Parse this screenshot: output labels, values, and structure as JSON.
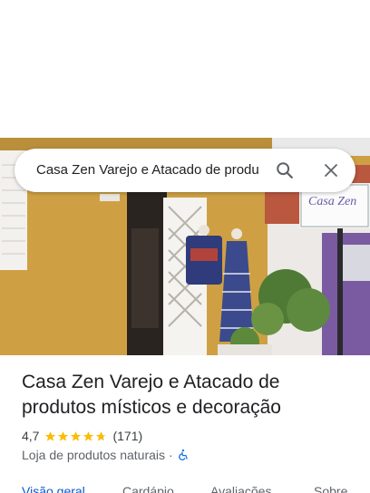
{
  "search": {
    "query": "Casa Zen Varejo e Atacado de produ"
  },
  "icons": {
    "search": "search-icon",
    "close": "close-icon",
    "wheelchair": "wheelchair-accessible-icon",
    "star": "star-icon"
  },
  "photo": {
    "sign_text": "Casa Zen"
  },
  "place": {
    "name": "Casa Zen Varejo e Atacado de produtos místicos e decoração",
    "rating": "4,7",
    "rating_value": 4.7,
    "review_count": "(171)",
    "category": "Loja de produtos naturais",
    "separator": "·"
  },
  "tabs": [
    {
      "label": "Visão geral",
      "active": true
    },
    {
      "label": "Cardápio",
      "active": false
    },
    {
      "label": "Avaliações",
      "active": false
    },
    {
      "label": "Sobre",
      "active": false
    }
  ],
  "colors": {
    "accent": "#0b57d0",
    "star": "#fbbc04",
    "wall": "#cfa043"
  }
}
